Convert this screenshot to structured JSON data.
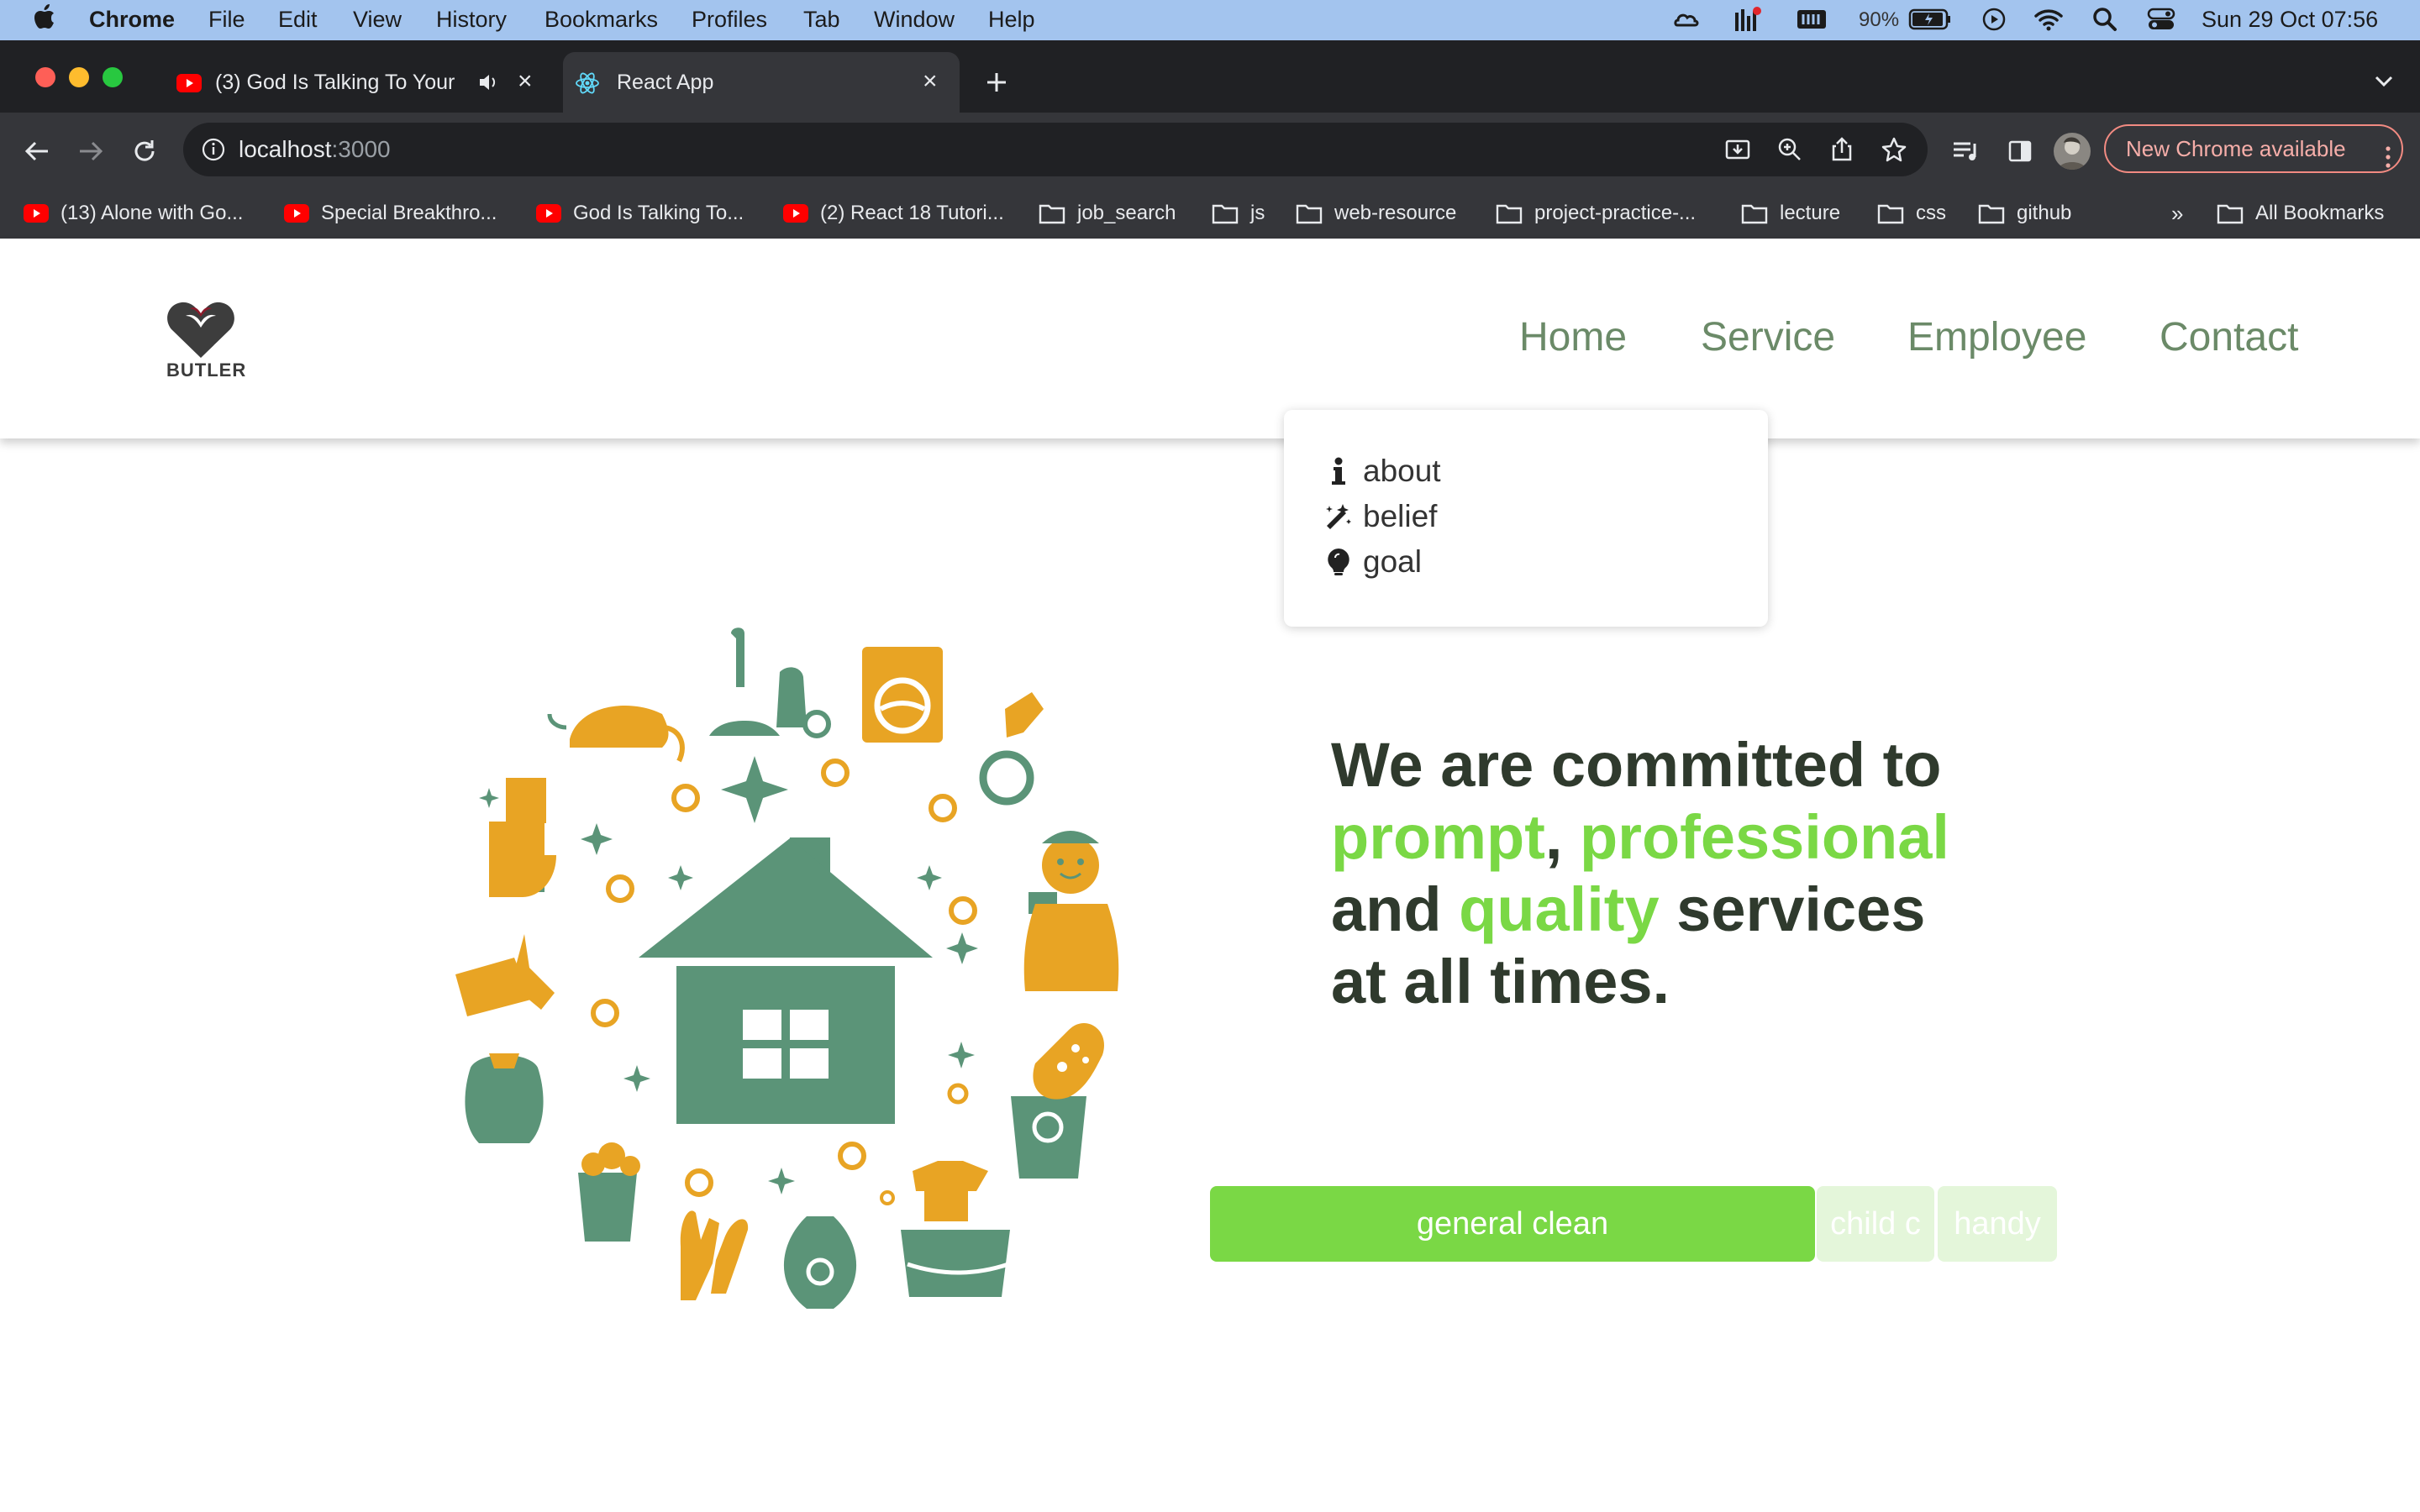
{
  "menubar": {
    "app_name": "Chrome",
    "items": [
      "File",
      "Edit",
      "View",
      "History",
      "Bookmarks",
      "Profiles",
      "Tab",
      "Window",
      "Help"
    ],
    "battery": "90%",
    "datetime": "Sun 29 Oct  07:56"
  },
  "browser": {
    "tabs": [
      {
        "title": "(3) God Is Talking To Your",
        "icon": "youtube-icon",
        "audio": true
      },
      {
        "title": "React App",
        "icon": "react-icon",
        "active": true
      }
    ],
    "url_host": "localhost",
    "url_port": ":3000",
    "update_button": "New Chrome available",
    "bookmarks": [
      {
        "label": "(13) Alone with Go...",
        "icon": "youtube-icon"
      },
      {
        "label": "Special Breakthro...",
        "icon": "youtube-icon"
      },
      {
        "label": "God Is Talking To...",
        "icon": "youtube-icon"
      },
      {
        "label": "(2) React 18 Tutori...",
        "icon": "youtube-icon"
      },
      {
        "label": "job_search",
        "icon": "folder-icon"
      },
      {
        "label": "js",
        "icon": "folder-icon"
      },
      {
        "label": "web-resource",
        "icon": "folder-icon"
      },
      {
        "label": "project-practice-...",
        "icon": "folder-icon"
      },
      {
        "label": "lecture",
        "icon": "folder-icon"
      },
      {
        "label": "css",
        "icon": "folder-icon"
      },
      {
        "label": "github",
        "icon": "folder-icon"
      }
    ],
    "overflow": "»",
    "all_bookmarks": "All Bookmarks"
  },
  "site": {
    "logo_text": "BUTLER",
    "nav": [
      "Home",
      "Service",
      "Employee",
      "Contact"
    ],
    "dropdown": [
      {
        "label": "about",
        "icon": "info-icon"
      },
      {
        "label": "belief",
        "icon": "magic-wand-icon"
      },
      {
        "label": "goal",
        "icon": "lightbulb-icon"
      }
    ],
    "headline": {
      "line1": "We are committed to",
      "w_prompt": "prompt",
      "comma": ",",
      "w_professional": "professional",
      "and": "and",
      "w_quality": "quality",
      "services": "services",
      "line4": "at all times."
    },
    "services": [
      "general clean",
      "child c",
      "handy"
    ]
  },
  "colors": {
    "accent_green": "#7ad845",
    "nav_green": "#6b8a68",
    "illustration_green": "#5b9478",
    "illustration_orange": "#e8a424",
    "headline_dark": "#2f3a2d"
  }
}
